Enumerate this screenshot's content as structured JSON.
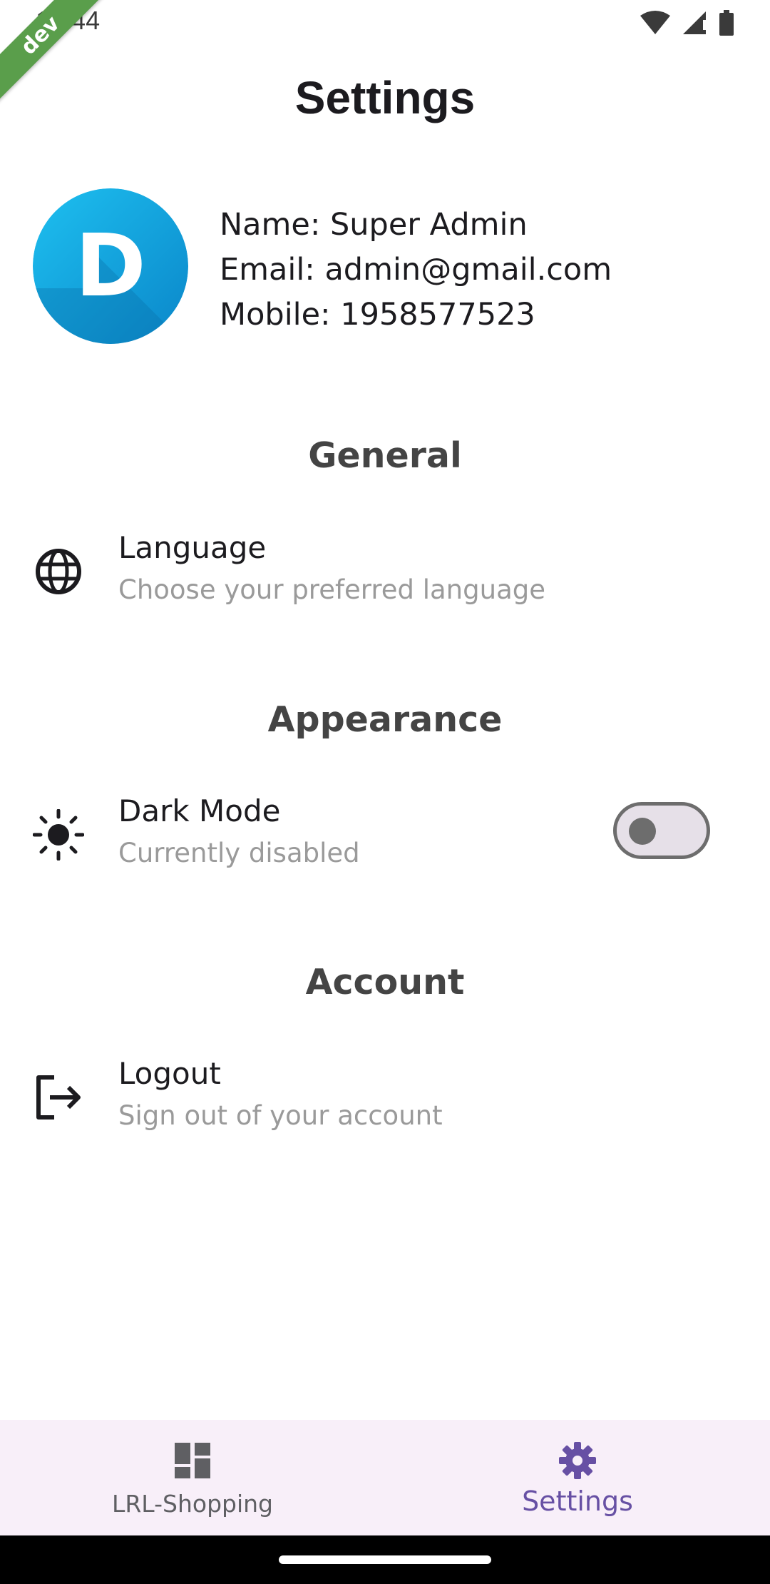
{
  "status_bar": {
    "time": "12:44"
  },
  "dev_banner": "dev",
  "page_title": "Settings",
  "profile": {
    "avatar_letter": "D",
    "name": "Name: Super Admin",
    "email": "Email: admin@gmail.com",
    "mobile": "Mobile: 1958577523"
  },
  "sections": {
    "general": {
      "title": "General",
      "items": [
        {
          "title": "Language",
          "subtitle": "Choose your preferred language",
          "icon": "globe-icon"
        }
      ]
    },
    "appearance": {
      "title": "Appearance",
      "items": [
        {
          "title": "Dark Mode",
          "subtitle": "Currently disabled",
          "icon": "sun-icon",
          "toggle_on": false
        }
      ]
    },
    "account": {
      "title": "Account",
      "items": [
        {
          "title": "Logout",
          "subtitle": "Sign out of your account",
          "icon": "logout-icon"
        }
      ]
    }
  },
  "bottom_nav": [
    {
      "label": "LRL-Shopping",
      "icon": "dashboard-icon",
      "active": false
    },
    {
      "label": "Settings",
      "icon": "gear-icon",
      "active": true
    }
  ],
  "colors": {
    "accent": "#6750a4",
    "nav_background": "#f8eff9",
    "dev_banner": "#5a9e4b",
    "avatar_light": "#1ec0f0",
    "avatar_dark": "#0a86c9"
  }
}
